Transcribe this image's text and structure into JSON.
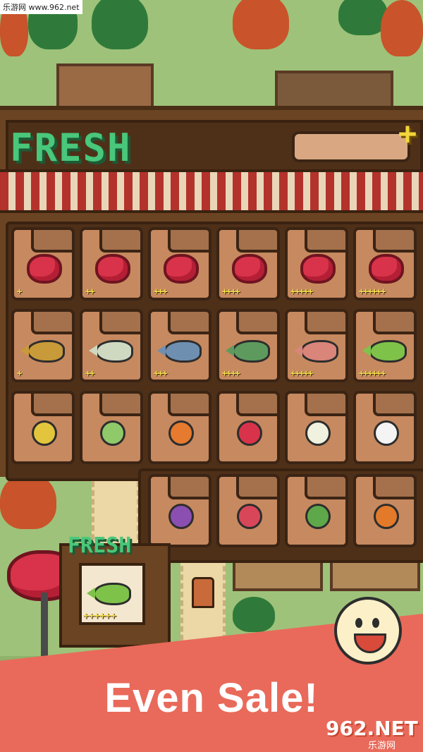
{
  "watermark": "乐游网 www.962.net",
  "header": {
    "title": "FRESH"
  },
  "coin_bar": {
    "plus_label": "+"
  },
  "rows": [
    {
      "category": "meat",
      "slots": [
        {
          "item": "meat",
          "stars": "+"
        },
        {
          "item": "meat",
          "stars": "++"
        },
        {
          "item": "meat",
          "stars": "+++"
        },
        {
          "item": "meat",
          "stars": "++++"
        },
        {
          "item": "meat",
          "stars": "+++++"
        },
        {
          "item": "meat",
          "stars": "++++++"
        }
      ]
    },
    {
      "category": "fish",
      "slots": [
        {
          "item": "fish",
          "color": "#c99a3a",
          "stars": "+"
        },
        {
          "item": "fish",
          "color": "#cfd9c2",
          "stars": "++"
        },
        {
          "item": "fish",
          "color": "#6f8fb0",
          "stars": "+++"
        },
        {
          "item": "fish",
          "color": "#5e9a5e",
          "stars": "++++"
        },
        {
          "item": "fish",
          "color": "#d9857a",
          "stars": "+++++"
        },
        {
          "item": "fish",
          "color": "#7fc24a",
          "stars": "++++++"
        }
      ]
    },
    {
      "category": "vegetable",
      "slots": [
        {
          "item": "corn",
          "color": "#e2c53c"
        },
        {
          "item": "leek",
          "color": "#8fc96a"
        },
        {
          "item": "carrot",
          "color": "#e67a2e"
        },
        {
          "item": "radish",
          "color": "#d8334a"
        },
        {
          "item": "turnip",
          "color": "#f1f1e0"
        },
        {
          "item": "daikon",
          "color": "#f4f4f4"
        }
      ]
    },
    {
      "category": "vegetable",
      "slots": [
        {
          "item": "eggplant",
          "color": "#8a4fb0"
        },
        {
          "item": "beet",
          "color": "#d8465a"
        },
        {
          "item": "cabbage",
          "color": "#5ea84a"
        },
        {
          "item": "pumpkin",
          "color": "#e27a2a"
        }
      ]
    }
  ],
  "shop": {
    "sign": "FRESH",
    "stars": "++++++"
  },
  "banner": {
    "text": "Even Sale!"
  },
  "logo": {
    "main": "962.NET",
    "sub": "乐游网"
  }
}
